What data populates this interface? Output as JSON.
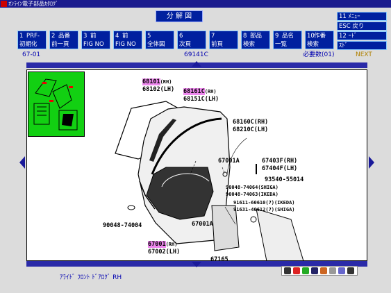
{
  "window": {
    "title": "ｵﾝﾗｲﾝ電子部品ｶﾀﾛｸﾞ"
  },
  "screen_caption": "分 解 図",
  "function_keys": [
    {
      "num": "1",
      "label1": "PRF-",
      "label2": "初期化"
    },
    {
      "num": "2",
      "label1": "品番",
      "label2": "前一頁"
    },
    {
      "num": "3",
      "label1": "前",
      "label2": "FIG NO"
    },
    {
      "num": "4",
      "label1": "前",
      "label2": "FIG NO"
    },
    {
      "num": "5",
      "label1": "",
      "label2": "全体図"
    },
    {
      "num": "6",
      "label1": "",
      "label2": "次頁"
    },
    {
      "num": "7",
      "label1": "",
      "label2": "前頁"
    },
    {
      "num": "8",
      "label1": "部品",
      "label2": "検索"
    },
    {
      "num": "9",
      "label1": "品名",
      "label2": "一覧"
    },
    {
      "num": "10",
      "label1": "作番",
      "label2": "検索"
    }
  ],
  "right_keys": [
    {
      "num": "11",
      "label": "ﾒﾆｭｰ"
    },
    {
      "num": "ESC",
      "label": "戻り"
    },
    {
      "num": "12",
      "label": "ｰﾄﾞ"
    },
    {
      "num": "",
      "label": "ｽﾄﾞ"
    }
  ],
  "info": {
    "fig_no": "67-01",
    "code": "69141C",
    "needed": "必要数(01)",
    "next": "NEXT"
  },
  "labels": {
    "p68101": "68101",
    "p68101_suffix": "(RH)",
    "p68102": "68102(LH)",
    "p68161": "68161C",
    "p68161_suffix": "(RH)",
    "p68151": "68151C(LH)",
    "p68160": "68160C(RH)",
    "p68210": "68210C(LH)",
    "p67001A": "67001A",
    "p67403": "67403F(RH)",
    "p67404": "67404F(LH)",
    "p93540": "93540-55014",
    "p90048a": "90048-74064(SHIGA)",
    "p90048b": "90048-74063(IKEDA)",
    "p91611": "91611-60610(7)(IKEDA)",
    "p91631": "91631-40612(7)(SHIGA)",
    "p90048c": "90048-74004",
    "p67001A2": "67001A",
    "p67001": "67001",
    "p67001_suffix": "(RH)",
    "p67002": "67002(LH)",
    "p67165": "67165"
  },
  "bottom_label": "ｱﾗｲﾄﾞ ﾌﾛﾝﾄ ﾄﾞｱﾛｸﾞ RH"
}
